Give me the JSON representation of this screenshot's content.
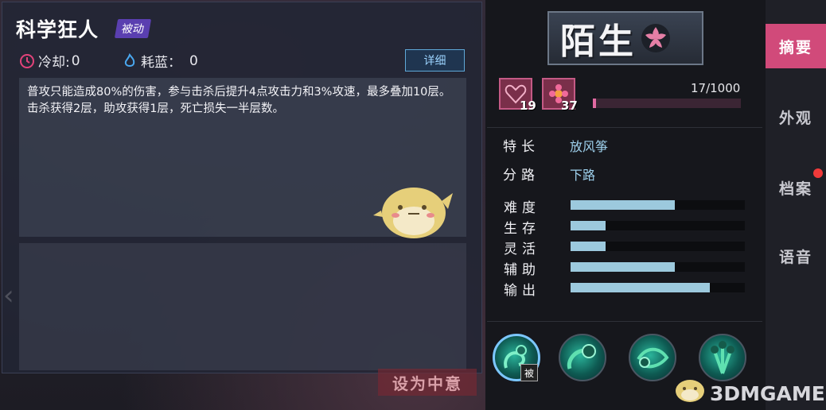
{
  "skill": {
    "name": "科学狂人",
    "type_badge": "被动",
    "cooldown_label": "冷却:",
    "cooldown_value": "0",
    "cost_label": "耗蓝：",
    "cost_value": "0",
    "detail_label": "详细",
    "description": "普攻只能造成80%的伤害，参与击杀后提升4点攻击力和3%攻速，最多叠加10层。击杀获得2层，助攻获得1层，死亡损失一半层数。",
    "set_favorite_label": "设为中意"
  },
  "hero": {
    "name_logo": "陌生",
    "badge_1_count": "19",
    "badge_2_count": "37",
    "progress_text": "17/1000",
    "progress_fraction": 0.017,
    "specialty_label": "特长",
    "specialty_value": "放风筝",
    "lane_label": "分路",
    "lane_value": "下路",
    "attributes": [
      {
        "label": "难度",
        "fraction": 0.6
      },
      {
        "label": "生存",
        "fraction": 0.2
      },
      {
        "label": "灵活",
        "fraction": 0.2
      },
      {
        "label": "辅助",
        "fraction": 0.6
      },
      {
        "label": "输出",
        "fraction": 0.8
      }
    ],
    "passive_tag": "被"
  },
  "tabs": [
    {
      "label": "摘要",
      "active": true
    },
    {
      "label": "外观",
      "active": false
    },
    {
      "label": "档案",
      "active": false,
      "notification": true
    },
    {
      "label": "语音",
      "active": false
    }
  ],
  "watermark": "3DMGAME",
  "colors": {
    "accent_pink": "#d14a7a",
    "progress_pink": "#e26aa2",
    "attr_bar": "#9cc9dd",
    "value_blue": "#9ed0ec"
  }
}
